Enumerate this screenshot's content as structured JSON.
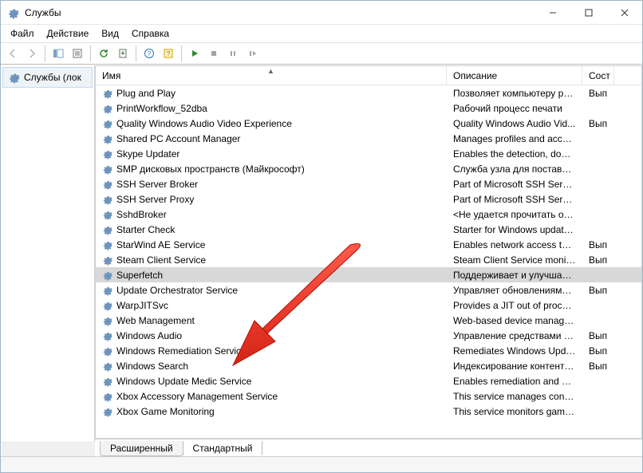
{
  "window": {
    "title": "Службы"
  },
  "menu": {
    "file": "Файл",
    "action": "Действие",
    "view": "Вид",
    "help": "Справка"
  },
  "tree": {
    "root": "Службы (лок"
  },
  "columns": {
    "name": "Имя",
    "description": "Описание",
    "state": "Сост"
  },
  "tabs": {
    "extended": "Расширенный",
    "standard": "Стандартный"
  },
  "services": [
    {
      "name": "Plug and Play",
      "description": "Позволяет компьютеру ра...",
      "state": "Вып",
      "selected": false
    },
    {
      "name": "PrintWorkflow_52dba",
      "description": "Рабочий процесс печати",
      "state": "",
      "selected": false
    },
    {
      "name": "Quality Windows Audio Video Experience",
      "description": "Quality Windows Audio Vid...",
      "state": "Вып",
      "selected": false
    },
    {
      "name": "Shared PC Account Manager",
      "description": "Manages profiles and accou...",
      "state": "",
      "selected": false
    },
    {
      "name": "Skype Updater",
      "description": "Enables the detection, down...",
      "state": "",
      "selected": false
    },
    {
      "name": "SMP дисковых пространств (Майкрософт)",
      "description": "Служба узла для поставщи...",
      "state": "",
      "selected": false
    },
    {
      "name": "SSH Server Broker",
      "description": "Part of Microsoft SSH Server...",
      "state": "",
      "selected": false
    },
    {
      "name": "SSH Server Proxy",
      "description": "Part of Microsoft SSH Server...",
      "state": "",
      "selected": false
    },
    {
      "name": "SshdBroker",
      "description": "<Не удается прочитать оп...",
      "state": "",
      "selected": false
    },
    {
      "name": "Starter Check",
      "description": "Starter for Windows updates...",
      "state": "",
      "selected": false
    },
    {
      "name": "StarWind AE Service",
      "description": "Enables network access to lo...",
      "state": "Вып",
      "selected": false
    },
    {
      "name": "Steam Client Service",
      "description": "Steam Client Service monito...",
      "state": "Вып",
      "selected": false
    },
    {
      "name": "Superfetch",
      "description": "Поддерживает и улучшает ...",
      "state": "",
      "selected": true
    },
    {
      "name": "Update Orchestrator Service",
      "description": "Управляет обновлениями ...",
      "state": "Вып",
      "selected": false
    },
    {
      "name": "WarpJITSvc",
      "description": "Provides a JIT out of process...",
      "state": "",
      "selected": false
    },
    {
      "name": "Web Management",
      "description": "Web-based device manage...",
      "state": "",
      "selected": false
    },
    {
      "name": "Windows Audio",
      "description": "Управление средствами ра...",
      "state": "Вып",
      "selected": false
    },
    {
      "name": "Windows Remediation Service",
      "description": "Remediates Windows Updat...",
      "state": "Вып",
      "selected": false
    },
    {
      "name": "Windows Search",
      "description": "Индексирование контента,...",
      "state": "Вып",
      "selected": false
    },
    {
      "name": "Windows Update Medic Service",
      "description": "Enables remediation and pr...",
      "state": "",
      "selected": false
    },
    {
      "name": "Xbox Accessory Management Service",
      "description": "This service manages conne...",
      "state": "",
      "selected": false
    },
    {
      "name": "Xbox Game Monitoring",
      "description": "This service monitors games.",
      "state": "",
      "selected": false
    }
  ]
}
